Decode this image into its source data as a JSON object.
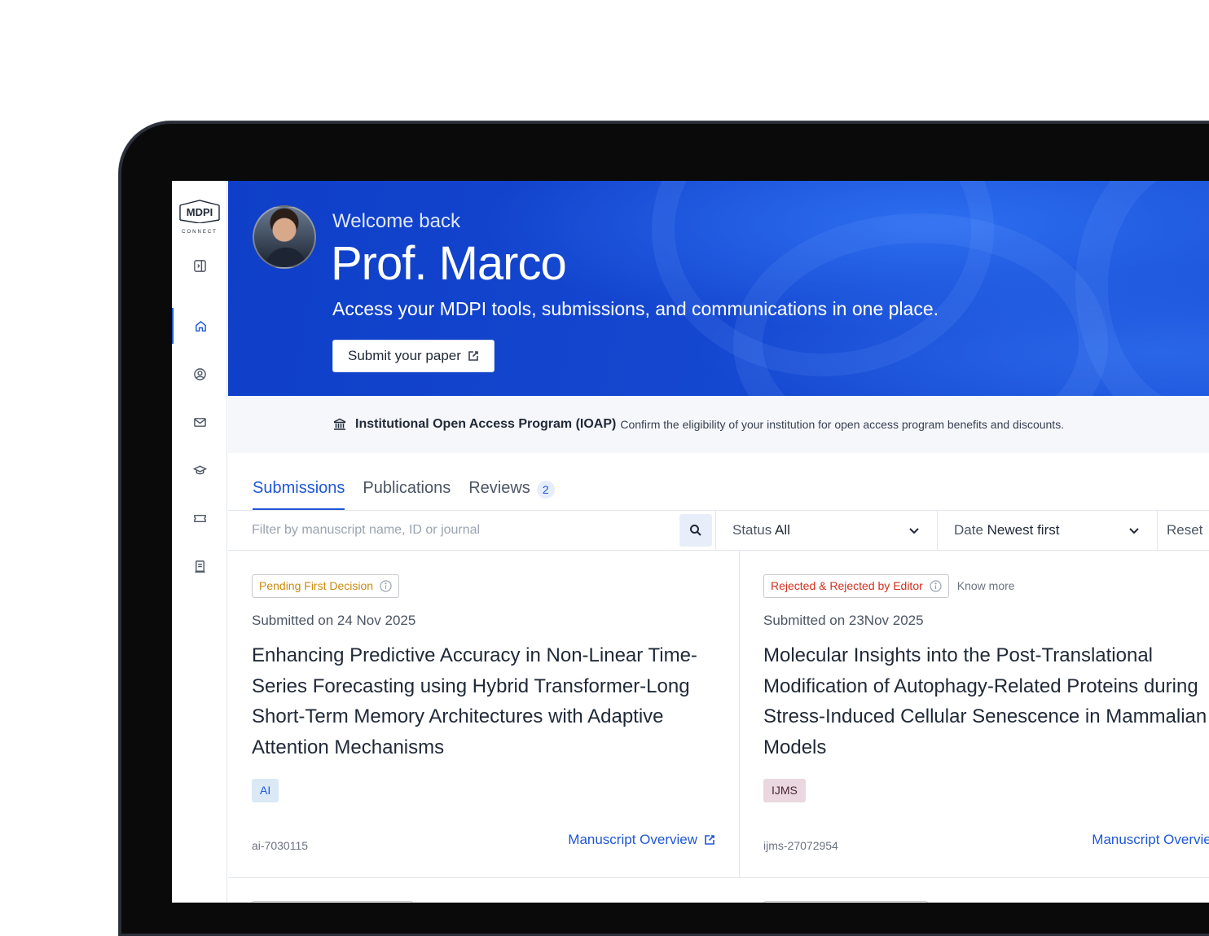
{
  "brand": {
    "logo_text": "MDPI",
    "logo_sub": "CONNECT"
  },
  "sidebar": {
    "items": [
      {
        "name": "sidebar-toggle",
        "icon": "panel-toggle-icon"
      },
      {
        "name": "sidebar-item-home",
        "icon": "home-icon",
        "active": true
      },
      {
        "name": "sidebar-item-profile",
        "icon": "user-circle-icon"
      },
      {
        "name": "sidebar-item-messages",
        "icon": "mail-icon"
      },
      {
        "name": "sidebar-item-education",
        "icon": "graduation-cap-icon"
      },
      {
        "name": "sidebar-item-vouchers",
        "icon": "ticket-icon"
      },
      {
        "name": "sidebar-item-documents",
        "icon": "document-icon"
      }
    ]
  },
  "hero": {
    "welcome": "Welcome back",
    "name": "Prof. Marco",
    "tagline": "Access your MDPI tools, submissions, and communications in one place.",
    "submit_label": "Submit your paper"
  },
  "ioap": {
    "title": "Institutional Open Access Program (IOAP)",
    "description": "Confirm the eligibility of your institution for open access program benefits and discounts."
  },
  "tabs": [
    {
      "label": "Submissions",
      "active": true
    },
    {
      "label": "Publications"
    },
    {
      "label": "Reviews",
      "badge": "2"
    }
  ],
  "filters": {
    "search_placeholder": "Filter by manuscript name, ID or journal",
    "status_label": "Status",
    "status_value": "All",
    "date_label": "Date",
    "date_value": "Newest first",
    "reset_label": "Reset"
  },
  "cards": [
    {
      "status": "Pending First Decision",
      "submitted": "Submitted on 24 Nov 2025",
      "title": "Enhancing Predictive Accuracy in Non-Linear Time-Series Forecasting using Hybrid Transformer-Long Short-Term Memory Architectures with Adaptive Attention Mechanisms",
      "journal": "AI",
      "id": "ai-7030115",
      "overview_label": "Manuscript Overview"
    },
    {
      "status": "Rejected & Rejected by Editor",
      "know_more": "Know more",
      "submitted": "Submitted on 23Nov 2025",
      "title": "Molecular Insights into the Post-Translational Modification of Autophagy-Related Proteins during Stress-Induced Cellular Senescence in Mammalian Models",
      "journal": "IJMS",
      "id": "ijms-27072954",
      "overview_label": "Manuscript Overview"
    }
  ],
  "colors": {
    "accent": "#1f57d6",
    "hero": "#1446cf",
    "pending": "#c98a0f",
    "rejected": "#d32f1e"
  }
}
